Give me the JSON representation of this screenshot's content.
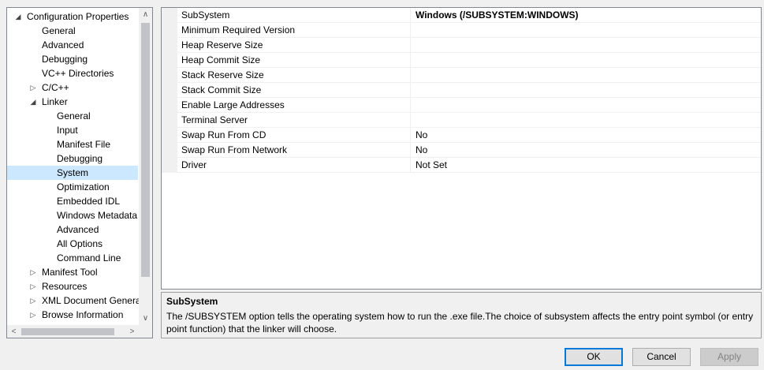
{
  "tree": {
    "items": [
      {
        "label": "Configuration Properties",
        "level": 0,
        "arrow": "◢"
      },
      {
        "label": "General",
        "level": 1,
        "arrow": ""
      },
      {
        "label": "Advanced",
        "level": 1,
        "arrow": ""
      },
      {
        "label": "Debugging",
        "level": 1,
        "arrow": ""
      },
      {
        "label": "VC++ Directories",
        "level": 1,
        "arrow": ""
      },
      {
        "label": "C/C++",
        "level": 1,
        "arrow": "▷"
      },
      {
        "label": "Linker",
        "level": 1,
        "arrow": "◢"
      },
      {
        "label": "General",
        "level": 2,
        "arrow": ""
      },
      {
        "label": "Input",
        "level": 2,
        "arrow": ""
      },
      {
        "label": "Manifest File",
        "level": 2,
        "arrow": ""
      },
      {
        "label": "Debugging",
        "level": 2,
        "arrow": ""
      },
      {
        "label": "System",
        "level": 2,
        "arrow": "",
        "selected": true
      },
      {
        "label": "Optimization",
        "level": 2,
        "arrow": ""
      },
      {
        "label": "Embedded IDL",
        "level": 2,
        "arrow": ""
      },
      {
        "label": "Windows Metadata",
        "level": 2,
        "arrow": ""
      },
      {
        "label": "Advanced",
        "level": 2,
        "arrow": ""
      },
      {
        "label": "All Options",
        "level": 2,
        "arrow": ""
      },
      {
        "label": "Command Line",
        "level": 2,
        "arrow": ""
      },
      {
        "label": "Manifest Tool",
        "level": 1,
        "arrow": "▷"
      },
      {
        "label": "Resources",
        "level": 1,
        "arrow": "▷"
      },
      {
        "label": "XML Document Genera",
        "level": 1,
        "arrow": "▷"
      },
      {
        "label": "Browse Information",
        "level": 1,
        "arrow": "▷"
      }
    ],
    "scroll_up_glyph": "∧",
    "scroll_down_glyph": "∨",
    "scroll_left_glyph": "<",
    "scroll_right_glyph": ">"
  },
  "properties": [
    {
      "name": "SubSystem",
      "value": "Windows (/SUBSYSTEM:WINDOWS)",
      "bold": true
    },
    {
      "name": "Minimum Required Version",
      "value": ""
    },
    {
      "name": "Heap Reserve Size",
      "value": ""
    },
    {
      "name": "Heap Commit Size",
      "value": ""
    },
    {
      "name": "Stack Reserve Size",
      "value": ""
    },
    {
      "name": "Stack Commit Size",
      "value": ""
    },
    {
      "name": "Enable Large Addresses",
      "value": ""
    },
    {
      "name": "Terminal Server",
      "value": ""
    },
    {
      "name": "Swap Run From CD",
      "value": "No"
    },
    {
      "name": "Swap Run From Network",
      "value": "No"
    },
    {
      "name": "Driver",
      "value": "Not Set"
    }
  ],
  "description": {
    "title": "SubSystem",
    "text": "The /SUBSYSTEM option tells the operating system how to run the .exe file.The choice of subsystem affects the entry point symbol (or entry point function) that the linker will choose."
  },
  "buttons": {
    "ok": "OK",
    "cancel": "Cancel",
    "apply": "Apply"
  },
  "colors": {
    "selection": "#cce8ff",
    "focus_border": "#0078d7"
  }
}
